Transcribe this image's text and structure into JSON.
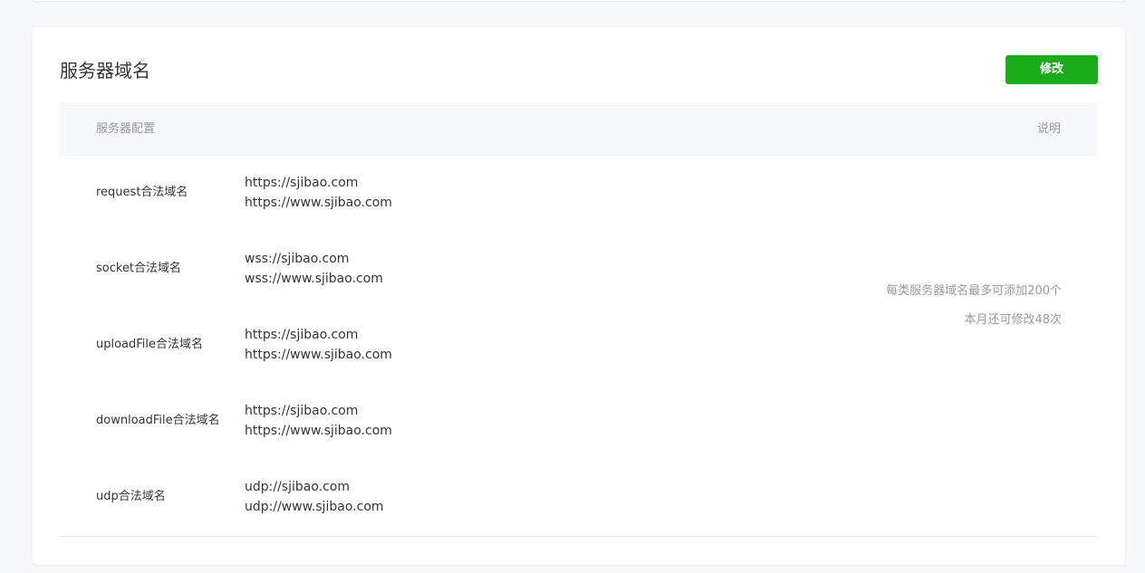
{
  "section": {
    "title": "服务器域名",
    "edit_label": "修改"
  },
  "table": {
    "header_config": "服务器配置",
    "header_desc": "说明"
  },
  "rows": [
    {
      "label": "request合法域名",
      "values": [
        "https://sjibao.com",
        "https://www.sjibao.com"
      ]
    },
    {
      "label": "socket合法域名",
      "values": [
        "wss://sjibao.com",
        "wss://www.sjibao.com"
      ]
    },
    {
      "label": "uploadFile合法域名",
      "values": [
        "https://sjibao.com",
        "https://www.sjibao.com"
      ]
    },
    {
      "label": "downloadFile合法域名",
      "values": [
        "https://sjibao.com",
        "https://www.sjibao.com"
      ]
    },
    {
      "label": "udp合法域名",
      "values": [
        "udp://sjibao.com",
        "udp://www.sjibao.com"
      ]
    }
  ],
  "notes": [
    "每类服务器域名最多可添加200个",
    "本月还可修改48次"
  ],
  "colors": {
    "accent": "#1aad19",
    "background": "#f6f7f9",
    "muted_text": "#9a9a9a"
  }
}
